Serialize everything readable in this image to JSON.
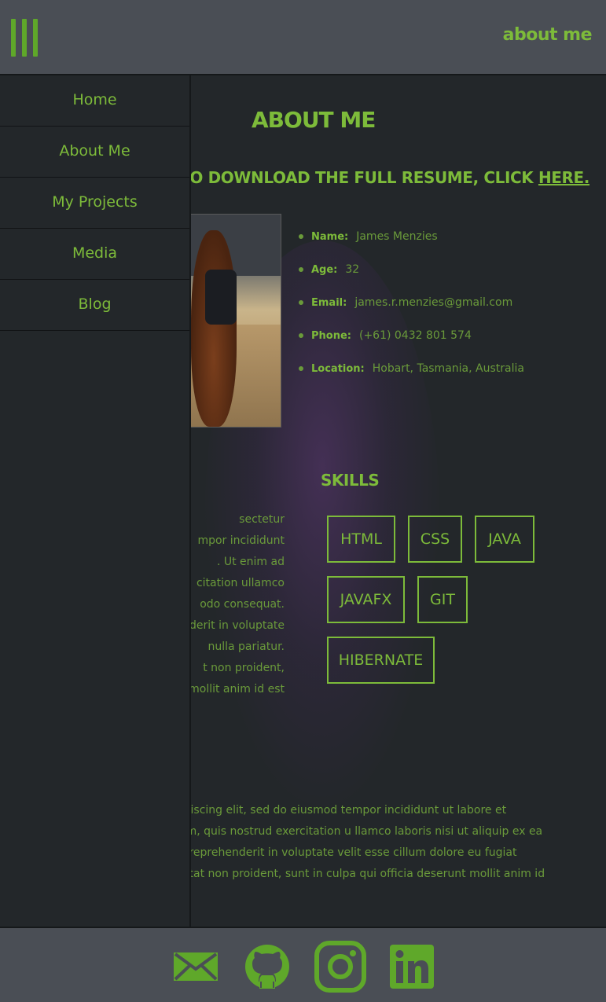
{
  "header": {
    "title": "about me",
    "menu_icon": "hamburger-menu-icon"
  },
  "sidebar": {
    "items": [
      {
        "label": "Home"
      },
      {
        "label": "About Me"
      },
      {
        "label": "My Projects"
      },
      {
        "label": "Media"
      },
      {
        "label": "Blog"
      }
    ]
  },
  "main": {
    "heading": "ABOUT ME",
    "download_prefix": "KE TO DOWNLOAD THE FULL RESUME, CLICK ",
    "download_link": "HERE.",
    "info": [
      {
        "label": "Name:",
        "value": "James Menzies"
      },
      {
        "label": "Age:",
        "value": "32"
      },
      {
        "label": "Email:",
        "value": "james.r.menzies@gmail.com"
      },
      {
        "label": "Phone:",
        "value": "(+61) 0432 801 574"
      },
      {
        "label": "Location:",
        "value": "Hobart, Tasmania, Australia"
      }
    ],
    "skills_heading": "SKILLS",
    "skills": [
      "HTML",
      "CSS",
      "JAVA",
      "JAVAFX",
      "GIT",
      "HIBERNATE"
    ],
    "para_left_lines": [
      "sectetur",
      "mpor incididunt",
      ". Ut enim ad",
      "citation ullamco",
      "odo consequat.",
      "derit in voluptate",
      "nulla pariatur.",
      "t non proident,",
      "mollit anim id est"
    ],
    "para_wide_lines": [
      "sectetur adipiscing elit, sed do eiusmod tempor incididunt ut labore et",
      "minim veniam, quis nostrud exercitation u llamco laboris nisi ut aliquip ex ea",
      "rure dolor in reprehenderit in voluptate velit esse cillum dolore eu fugiat",
      "uecat cupidatat non proident, sunt in culpa qui officia deserunt mollit anim id"
    ]
  },
  "footer": {
    "icons": [
      "email-icon",
      "github-icon",
      "instagram-icon",
      "linkedin-icon"
    ]
  },
  "colors": {
    "accent": "#7dbb3a",
    "bar_bg": "#4a4e55",
    "page_bg": "#23272a"
  }
}
